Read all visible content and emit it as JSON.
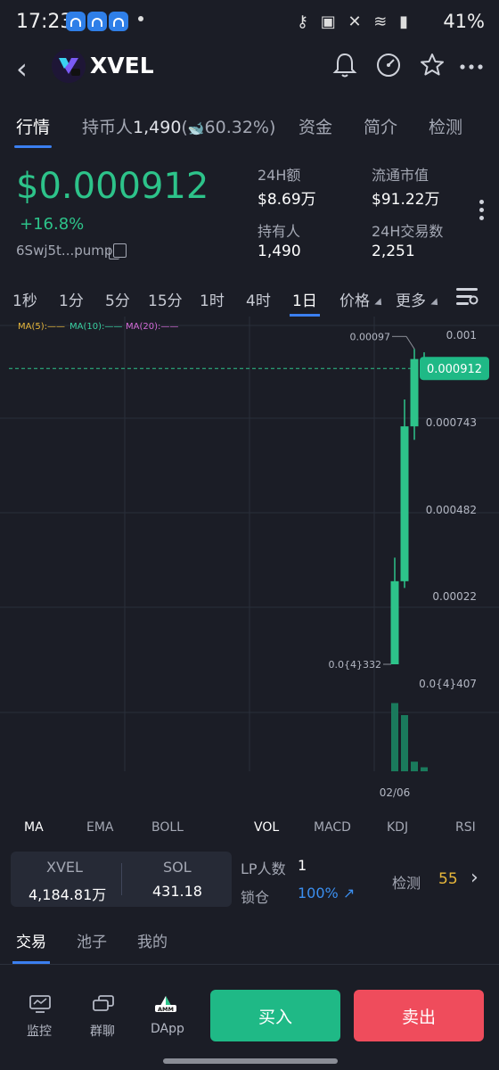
{
  "status_bar": {
    "time": "17:23",
    "battery": "41%"
  },
  "header": {
    "title": "XVEL"
  },
  "tabs": [
    {
      "label": "行情"
    },
    {
      "label": "持币人"
    },
    {
      "label": "1,490"
    },
    {
      "label": "("
    },
    {
      "label": "60.32%)"
    },
    {
      "label": "资金"
    },
    {
      "label": "简介"
    },
    {
      "label": "检测"
    }
  ],
  "price": {
    "value": "$0.000912",
    "change": "+16.8%",
    "address": "6Swj5t...pump"
  },
  "stats": {
    "vol24h_label": "24H额",
    "vol24h_value": "$8.69万",
    "mcap_label": "流通市值",
    "mcap_value": "$91.22万",
    "holders_label": "持有人",
    "holders_value": "1,490",
    "tx24h_label": "24H交易数",
    "tx24h_value": "2,251"
  },
  "intervals": [
    "1秒",
    "1分",
    "5分",
    "15分",
    "1时",
    "4时",
    "1日",
    "价格",
    "更多"
  ],
  "ma_legend": {
    "ma5": "MA(5):——",
    "ma10": "MA(10):——",
    "ma20": "MA(20):——"
  },
  "colors": {
    "up": "#2dc38a",
    "down": "#ef4c5c",
    "accent": "#3b7ff0",
    "ma5": "#e7b73b",
    "ma10": "#38d0a0",
    "ma20": "#d46bd8"
  },
  "chart_data": {
    "type": "candlestick",
    "y_axis_labels": [
      "0.001",
      "0.000743",
      "0.000482",
      "0.00022",
      "0.0{4}407"
    ],
    "current_price_label": "0.000912",
    "high_label": "0.00097",
    "low_label": "0.0{4}332",
    "x_axis_labels": [
      "02/06"
    ],
    "candles": [
      {
        "open": 3.32e-05,
        "close": 0.00028,
        "high": 0.00035,
        "low": 3.32e-05
      },
      {
        "open": 0.00028,
        "close": 0.00074,
        "high": 0.00082,
        "low": 0.00026
      },
      {
        "open": 0.00074,
        "close": 0.00094,
        "high": 0.00097,
        "low": 0.0007
      },
      {
        "open": 0.00094,
        "close": 0.000912,
        "high": 0.00096,
        "low": 0.00088
      }
    ],
    "volume_relative": [
      0.85,
      0.7,
      0.12,
      0.05
    ],
    "grid": true
  },
  "indicators": {
    "main": [
      "MA",
      "EMA",
      "BOLL"
    ],
    "sub": [
      "VOL",
      "MACD",
      "KDJ",
      "RSI"
    ]
  },
  "lp": {
    "token_label": "XVEL",
    "token_value": "4,184.81万",
    "sol_label": "SOL",
    "sol_value": "431.18",
    "lp_count_label": "LP人数",
    "lp_count_value": "1",
    "lock_label": "锁仓",
    "lock_value": "100%",
    "check_label": "检测",
    "check_value": "55"
  },
  "bottom_tabs": [
    "交易",
    "池子",
    "我的"
  ],
  "bottom_nav": [
    "监控",
    "群聊",
    "DApp"
  ],
  "actions": {
    "buy": "买入",
    "sell": "卖出"
  }
}
